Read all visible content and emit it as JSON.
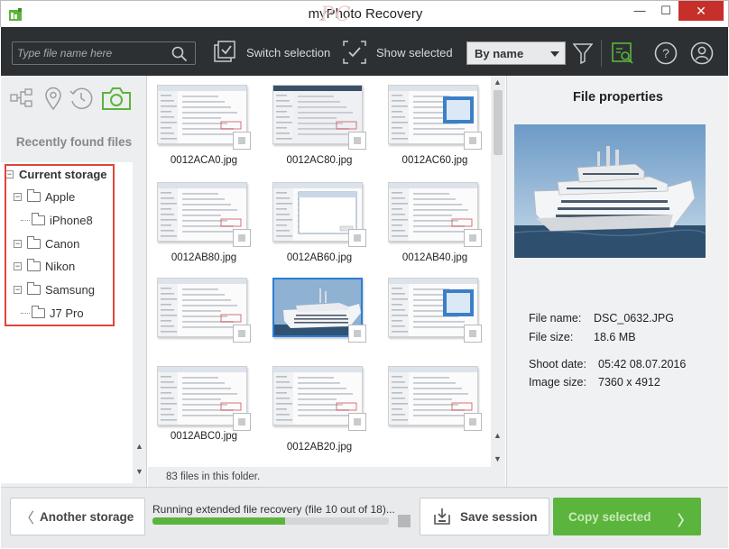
{
  "app": {
    "title": "myPhoto Recovery",
    "watermark": "PC"
  },
  "window": {
    "minimize": "—",
    "maximize": "☐",
    "close": "✕"
  },
  "toolbar": {
    "search_placeholder": "Type file name here",
    "switch_selection": "Switch selection",
    "show_selected": "Show selected",
    "sort_value": "By name",
    "icons": [
      "search-icon",
      "switch-selection-icon",
      "show-selected-icon",
      "filter-icon",
      "preview-icon",
      "help-icon",
      "user-icon"
    ]
  },
  "sidebar": {
    "mode_icons": [
      "tree-icon",
      "location-icon",
      "clock-icon",
      "camera-icon"
    ],
    "recent_label": "Recently found files",
    "tree": {
      "root": "Current storage",
      "items": [
        {
          "label": "Apple",
          "children": [
            "iPhone8"
          ]
        },
        {
          "label": "Canon",
          "children": []
        },
        {
          "label": "Nikon",
          "children": []
        },
        {
          "label": "Samsung",
          "children": [
            "J7 Pro"
          ]
        }
      ]
    }
  },
  "grid": {
    "files": [
      {
        "name": "0012ACA0.jpg",
        "kind": "screen"
      },
      {
        "name": "0012AC80.jpg",
        "kind": "screen-dark"
      },
      {
        "name": "0012AC60.jpg",
        "kind": "screen-blue"
      },
      {
        "name": "0012AB80.jpg",
        "kind": "screen"
      },
      {
        "name": "0012AB60.jpg",
        "kind": "dialog"
      },
      {
        "name": "0012AB40.jpg",
        "kind": "screen"
      },
      {
        "name": "",
        "kind": "screen"
      },
      {
        "name": "",
        "kind": "ship",
        "selected": true
      },
      {
        "name": "",
        "kind": "screen-blue"
      },
      {
        "name": "0012ABC0.jpg",
        "kind": "screen"
      },
      {
        "name": "0012AB20.jpg",
        "kind": "screen"
      },
      {
        "name": "",
        "kind": "screen"
      }
    ],
    "folder_count": "83 files in this folder."
  },
  "properties": {
    "title": "File properties",
    "rows": [
      {
        "key": "File name:",
        "value": "DSC_0632.JPG"
      },
      {
        "key": "File size:",
        "value": "18.6 MB"
      },
      {
        "key": "Shoot date:",
        "value": "05:42 08.07.2016"
      },
      {
        "key": "Image size:",
        "value": "7360 x 4912"
      }
    ]
  },
  "footer": {
    "another_storage": "Another storage",
    "status": "Running extended file recovery (file 10 out of 18)...",
    "progress": 0.56,
    "save_session": "Save session",
    "copy_selected": "Copy selected"
  },
  "colors": {
    "toolbar_bg": "#2d3033",
    "accent_green": "#5bb43c",
    "selection_blue": "#2a7fd4",
    "highlight_red": "#e0453a"
  }
}
